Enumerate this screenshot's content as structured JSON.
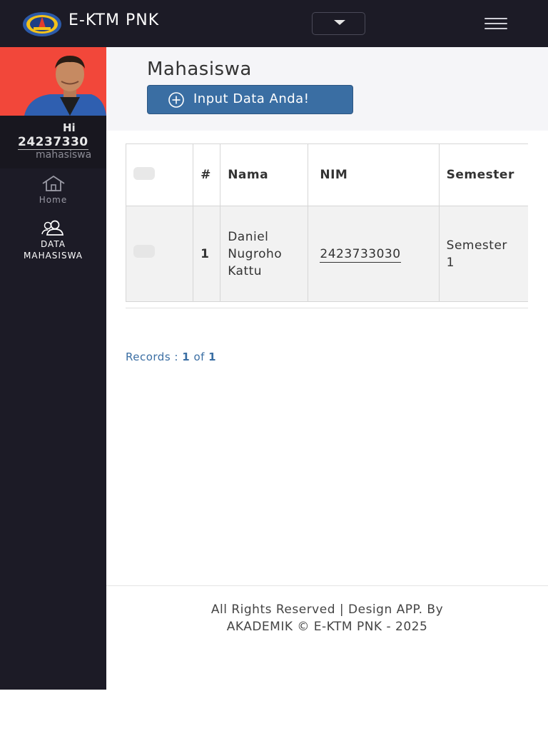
{
  "app": {
    "brand": "E-KTM PNK"
  },
  "topbar": {
    "dropdown_icon": "caret-down-icon",
    "menu_icon": "hamburger-icon"
  },
  "user": {
    "greeting": "Hi",
    "id": "24237330",
    "role": "mahasiswa"
  },
  "sidebar": {
    "items": [
      {
        "label": "Home",
        "icon": "home-icon"
      },
      {
        "label_line1": "DATA",
        "label_line2": "MAHASISWA",
        "icon": "users-icon"
      }
    ]
  },
  "page": {
    "title": "Mahasiswa",
    "input_button": "Input Data Anda!"
  },
  "table": {
    "headers": [
      "#",
      "Nama",
      "NIM",
      "Semester"
    ],
    "rows": [
      {
        "num": "1",
        "nama_line1": "Daniel",
        "nama_line2": "Nugroho",
        "nama_line3": "Kattu",
        "nim": "2423733030",
        "semester_line1": "Semester",
        "semester_line2": "1"
      }
    ]
  },
  "records": {
    "prefix": "Records : ",
    "current": "1",
    "of": " of ",
    "total": "1"
  },
  "footer": {
    "line1": "All Rights Reserved | Design APP. By",
    "line2": "AKADEMIK © E-KTM PNK - 2025"
  },
  "colors": {
    "navbar": "#1c1b26",
    "avatar_bg": "#f2473a",
    "primary": "#3a6ea3"
  }
}
